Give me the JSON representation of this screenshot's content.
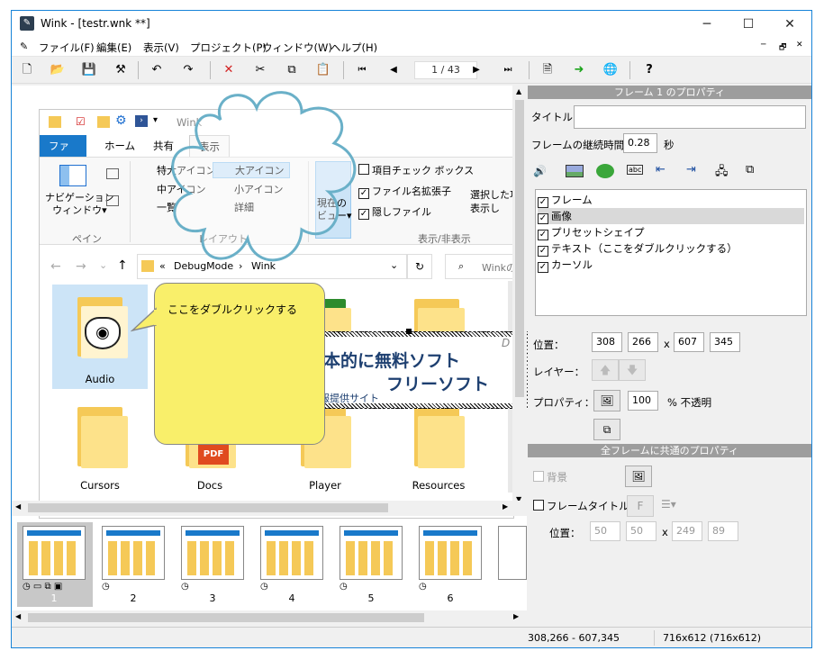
{
  "window": {
    "title": "Wink - [testr.wnk **]",
    "min": "─",
    "max": "☐",
    "close": "✕"
  },
  "menus": [
    "ファイル(F)",
    "編集(E)",
    "表示(V)",
    "プロジェクト(P)",
    "ウィンドウ(W)",
    "ヘルプ(H)"
  ],
  "mdi": {
    "min": "─",
    "restore": "🗗",
    "close": "✕"
  },
  "toolbar": {
    "page": "1 / 43"
  },
  "explorer": {
    "title": "Wink",
    "tabs": [
      "ファイル",
      "ホーム",
      "共有",
      "表示"
    ],
    "nav_pane": "ナビゲーション\nウィンドウ▾",
    "group_pane": "ペイン",
    "layouts": [
      "特大アイコン",
      "大アイコン",
      "中アイコン",
      "小アイコン",
      "一覧",
      "詳細"
    ],
    "group_layout": "レイアウト",
    "current_view": "現在の\nビュー▾",
    "checks": [
      "項目チェック ボックス",
      "ファイル名拡張子",
      "隠しファイル"
    ],
    "selected_hide": "選択した項\n表示し",
    "group_show": "表示/非表示",
    "address": [
      "«",
      "DebugMode",
      "›",
      "Wink"
    ],
    "search": "Winkの",
    "folders": [
      "Audio",
      "Cursors",
      "Docs",
      "Player",
      "Resources"
    ]
  },
  "callout": {
    "text": "ここをダブルクリックする"
  },
  "banner": {
    "line1": "本的に無料ソフト",
    "line2": "フリーソフト",
    "line3": "報提供サイト",
    "logo": "D"
  },
  "thumbnails": [
    "1",
    "2",
    "3",
    "4",
    "5",
    "6"
  ],
  "props": {
    "heading": "フレーム 1 のプロパティ",
    "title_label": "タイトル",
    "title_value": "",
    "duration_label": "フレームの継続時間",
    "duration_value": "0.28",
    "duration_unit": "秒",
    "layers": [
      "フレーム",
      "画像",
      "プリセットシェイプ",
      "テキスト（ここをダブルクリックする）",
      "カーソル"
    ],
    "pos_label": "位置：",
    "pos": [
      "308",
      "266",
      "607",
      "345"
    ],
    "x_sep": "x",
    "layer_label": "レイヤー：",
    "prop_label": "プロパティ：",
    "opacity": "100",
    "opacity_unit": "% 不透明"
  },
  "common": {
    "heading": "全フレームに共通のプロパティ",
    "bg_label": "背景",
    "frame_title_label": "フレームタイトル",
    "pos_label": "位置：",
    "pos": [
      "50",
      "50",
      "249",
      "89"
    ],
    "x_sep": "x"
  },
  "status": {
    "coords": "308,266 - 607,345",
    "size": "716x612 (716x612)"
  },
  "colors": {
    "accent": "#1783d8",
    "callout": "#f9ef6a",
    "folder": "#f5c957",
    "header": "#9d9d9d"
  }
}
